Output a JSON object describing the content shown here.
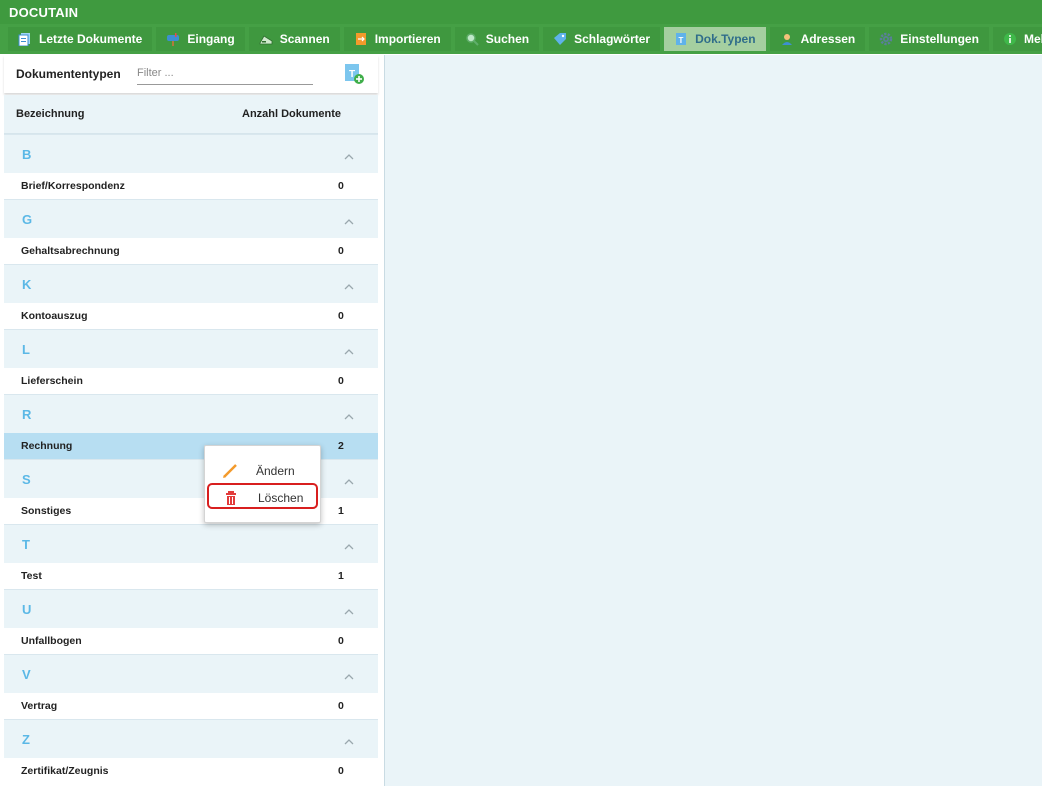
{
  "app": {
    "title": "DOCUTAIN"
  },
  "nav": [
    {
      "label": "Letzte Dokumente",
      "icon": "documents-icon"
    },
    {
      "label": "Eingang",
      "icon": "mailbox-icon"
    },
    {
      "label": "Scannen",
      "icon": "scanner-icon"
    },
    {
      "label": "Importieren",
      "icon": "import-icon"
    },
    {
      "label": "Suchen",
      "icon": "search-icon"
    },
    {
      "label": "Schlagwörter",
      "icon": "tag-icon"
    },
    {
      "label": "Dok.Typen",
      "icon": "doctype-icon",
      "active": true
    },
    {
      "label": "Adressen",
      "icon": "person-icon"
    },
    {
      "label": "Einstellungen",
      "icon": "gear-icon"
    },
    {
      "label": "Mehr",
      "icon": "info-icon"
    }
  ],
  "panel": {
    "title": "Dokumententypen",
    "filter_placeholder": "Filter ...",
    "col_name": "Bezeichnung",
    "col_count": "Anzahl Dokumente"
  },
  "groups": [
    {
      "letter": "B",
      "items": [
        {
          "name": "Brief/Korrespondenz",
          "count": "0"
        }
      ]
    },
    {
      "letter": "G",
      "items": [
        {
          "name": "Gehaltsabrechnung",
          "count": "0"
        }
      ]
    },
    {
      "letter": "K",
      "items": [
        {
          "name": "Kontoauszug",
          "count": "0"
        }
      ]
    },
    {
      "letter": "L",
      "items": [
        {
          "name": "Lieferschein",
          "count": "0"
        }
      ]
    },
    {
      "letter": "R",
      "items": [
        {
          "name": "Rechnung",
          "count": "2",
          "selected": true
        }
      ]
    },
    {
      "letter": "S",
      "items": [
        {
          "name": "Sonstiges",
          "count": "1"
        }
      ]
    },
    {
      "letter": "T",
      "items": [
        {
          "name": "Test",
          "count": "1"
        }
      ]
    },
    {
      "letter": "U",
      "items": [
        {
          "name": "Unfallbogen",
          "count": "0"
        }
      ]
    },
    {
      "letter": "V",
      "items": [
        {
          "name": "Vertrag",
          "count": "0"
        }
      ]
    },
    {
      "letter": "Z",
      "items": [
        {
          "name": "Zertifikat/Zeugnis",
          "count": "0"
        }
      ]
    }
  ],
  "context_menu": {
    "edit_label": "Ändern",
    "delete_label": "Löschen",
    "highlight_color": "#d81f1f"
  },
  "colors": {
    "brand_green": "#45a045",
    "letter_blue": "#5bb8e6",
    "selected_row": "#b7def2"
  }
}
